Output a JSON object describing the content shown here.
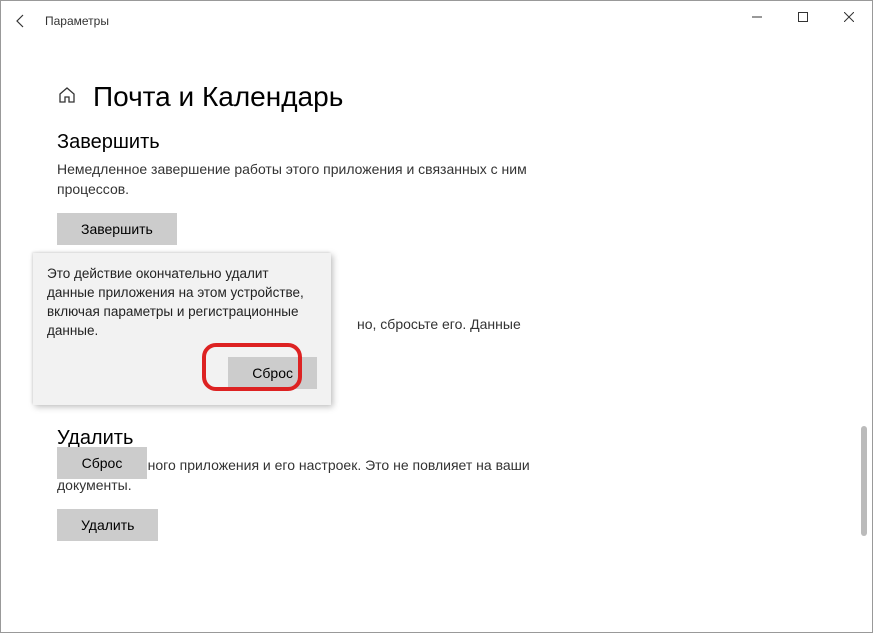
{
  "window": {
    "title": "Параметры"
  },
  "page": {
    "title": "Почта и Календарь"
  },
  "terminate": {
    "title": "Завершить",
    "desc": "Немедленное завершение работы этого приложения и связанных с ним процессов.",
    "button": "Завершить"
  },
  "reset": {
    "partial_visible_text": "но, сбросьте его. Данные",
    "button": "Сброс"
  },
  "remove": {
    "title": "Удалить",
    "desc": "Удаление данного приложения и его настроек. Это не повлияет на ваши документы.",
    "button": "Удалить"
  },
  "flyout": {
    "text": "Это действие окончательно удалит данные приложения на этом устройстве, включая параметры и регистрационные данные.",
    "confirm": "Сброс"
  }
}
